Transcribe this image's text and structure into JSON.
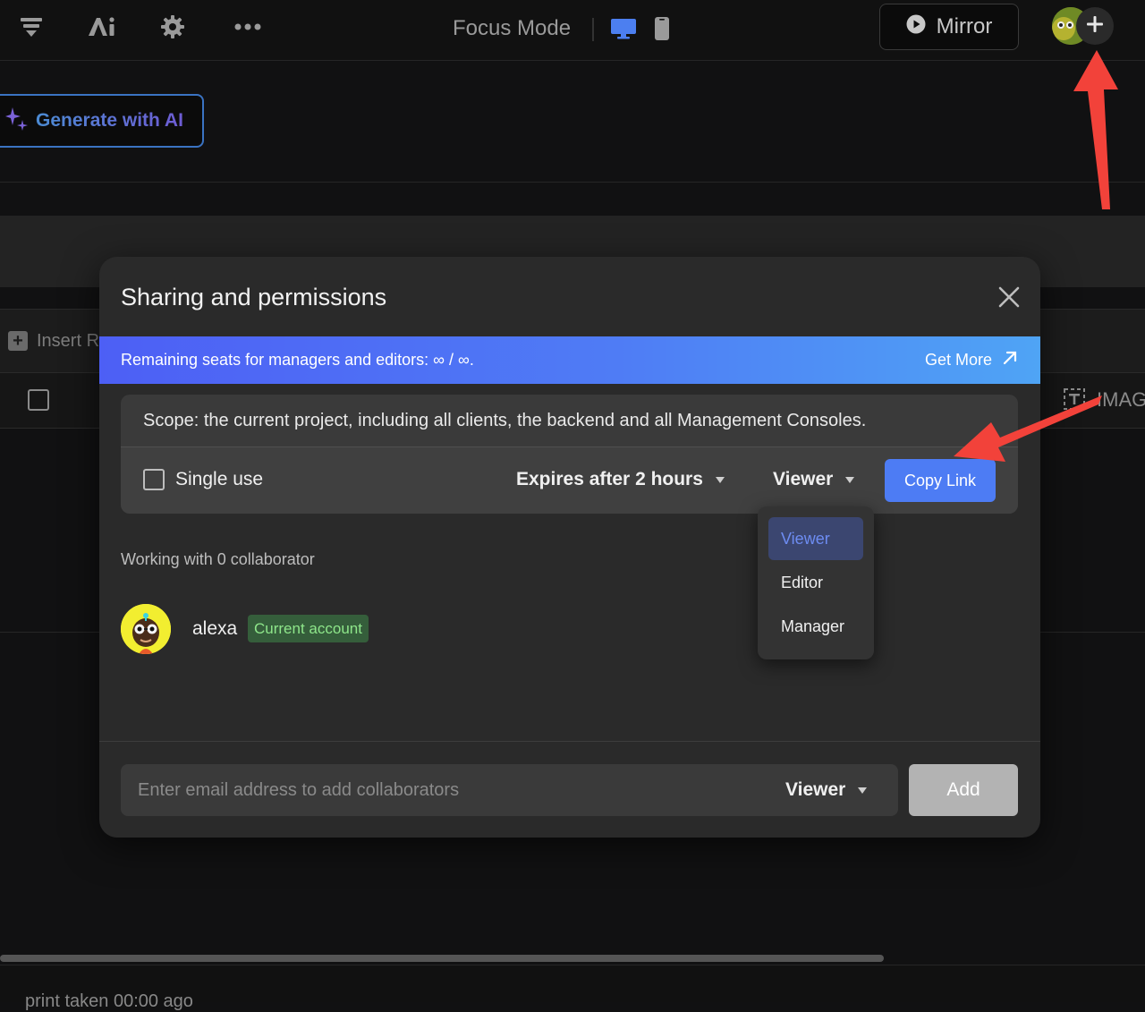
{
  "toolbar": {
    "focus_mode_label": "Focus Mode",
    "mirror_label": "Mirror",
    "icons": [
      "layers-icon",
      "ai-icon",
      "gear-icon",
      "more-icon",
      "desktop-icon",
      "mobile-icon",
      "play-icon",
      "plus-icon"
    ]
  },
  "background": {
    "generate_ai_label": "Generate with AI",
    "insert_label": "Insert R",
    "image_column_label": "IMAG",
    "bottom_text": "print taken 00:00 ago"
  },
  "modal": {
    "title": "Sharing and permissions",
    "banner": {
      "text": "Remaining seats for managers and editors: ∞ / ∞.",
      "get_more_label": "Get More"
    },
    "scope_text": "Scope: the current project, including all clients, the backend and all Management Consoles.",
    "single_use_label": "Single use",
    "expires_label": "Expires after 2 hours",
    "role_label": "Viewer",
    "copy_link_label": "Copy Link",
    "collaborators_heading": "Working with 0 collaborator",
    "user": {
      "name": "alexa",
      "badge": "Current account"
    },
    "email_placeholder": "Enter email address to add collaborators",
    "email_role_label": "Viewer",
    "add_label": "Add"
  },
  "role_menu": {
    "items": [
      "Viewer",
      "Editor",
      "Manager"
    ],
    "selected": "Viewer"
  },
  "colors": {
    "accent": "#4d7cf4",
    "banner_start": "#4d5ff5",
    "banner_end": "#4fa4f5",
    "badge_text": "#8ee68a",
    "annotation_arrow": "#f2423a"
  }
}
